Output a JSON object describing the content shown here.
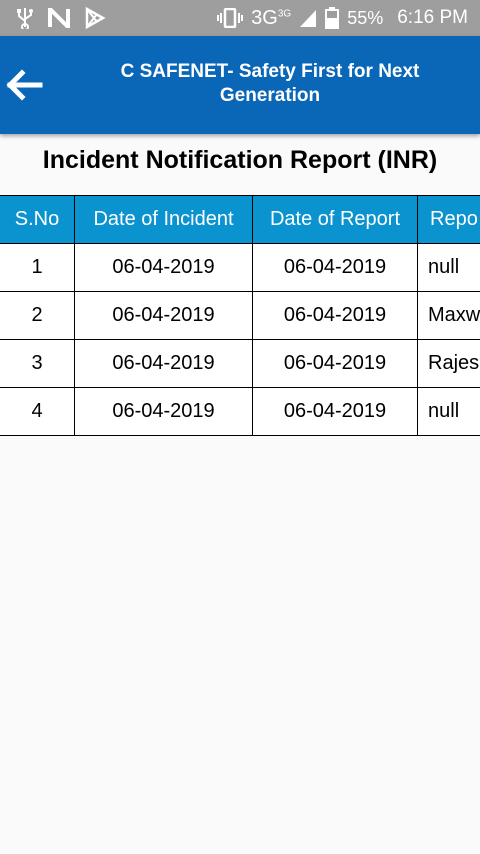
{
  "status_bar": {
    "battery": "55%",
    "network": "3G",
    "network_sup": "3G",
    "time": "6:16 PM"
  },
  "app_bar": {
    "title_line1": "C SAFENET- Safety First for Next",
    "title_line2": "Generation"
  },
  "page_title": "Incident Notification Report (INR)",
  "table": {
    "headers": [
      "S.No",
      "Date of Incident",
      "Date of Report",
      "Repo"
    ],
    "rows": [
      [
        "1",
        "06-04-2019",
        "06-04-2019",
        "null"
      ],
      [
        "2",
        "06-04-2019",
        "06-04-2019",
        "Maxw"
      ],
      [
        "3",
        "06-04-2019",
        "06-04-2019",
        "Rajes"
      ],
      [
        "4",
        "06-04-2019",
        "06-04-2019",
        "null"
      ]
    ]
  },
  "colors": {
    "app_bar": "#0a67b8",
    "table_header": "#0b93cf",
    "status_bar": "#9e9e9e"
  }
}
